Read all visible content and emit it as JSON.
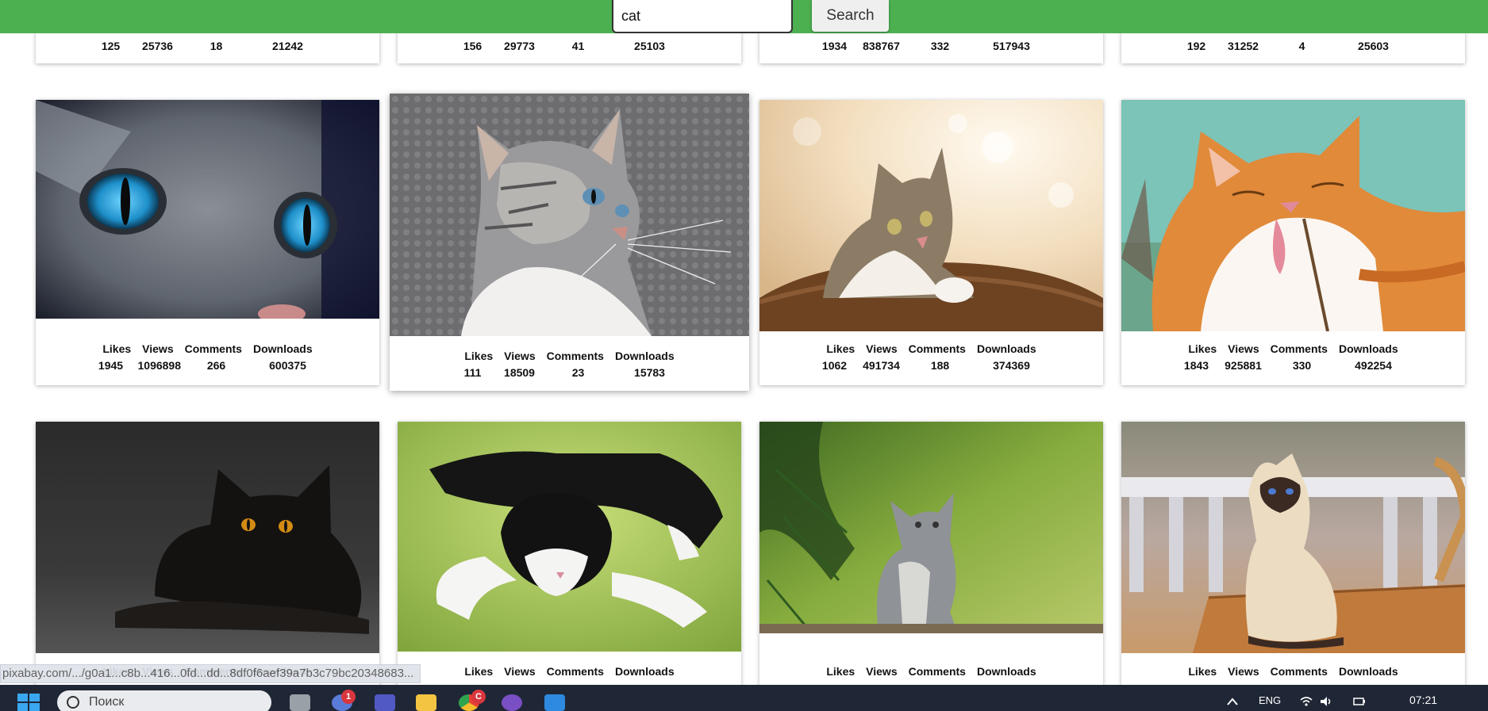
{
  "search": {
    "value": "cat",
    "button_label": "Search"
  },
  "stat_labels": [
    "Likes",
    "Views",
    "Comments",
    "Downloads"
  ],
  "rows": [
    {
      "cards": [
        {
          "stats": [
            "125",
            "25736",
            "18",
            "21242"
          ]
        },
        {
          "stats": [
            "156",
            "29773",
            "41",
            "25103"
          ]
        },
        {
          "stats": [
            "1934",
            "838767",
            "332",
            "517943"
          ]
        },
        {
          "stats": [
            "192",
            "31252",
            "4",
            "25603"
          ]
        }
      ]
    },
    {
      "cards": [
        {
          "photo": "cat-blue-eyes-closeup-photo",
          "stats": [
            "1945",
            "1096898",
            "266",
            "600375"
          ]
        },
        {
          "photo": "grey-tabby-cat-photo",
          "stats": [
            "111",
            "18509",
            "23",
            "15783"
          ]
        },
        {
          "photo": "kitten-on-cushion-photo",
          "stats": [
            "1062",
            "491734",
            "188",
            "374369"
          ]
        },
        {
          "photo": "orange-cat-licking-photo",
          "stats": [
            "1843",
            "925881",
            "330",
            "492254"
          ]
        }
      ]
    },
    {
      "cards": [
        {
          "photo": "black-cat-photo",
          "stats": []
        },
        {
          "photo": "black-white-cat-sleeping-photo",
          "stats": []
        },
        {
          "photo": "kitten-in-grass-photo",
          "stats": []
        },
        {
          "photo": "siamese-cat-photo",
          "stats": []
        }
      ]
    }
  ],
  "status_url": "pixabay.com/.../g0a1...c8b...416...0fd...dd...8df0f6aef39a7b3c79bc20348683...",
  "taskbar": {
    "search_placeholder": "Поиск",
    "badge_count": "1",
    "chrome_badge": "C",
    "language": "ENG",
    "time": "07:21"
  }
}
